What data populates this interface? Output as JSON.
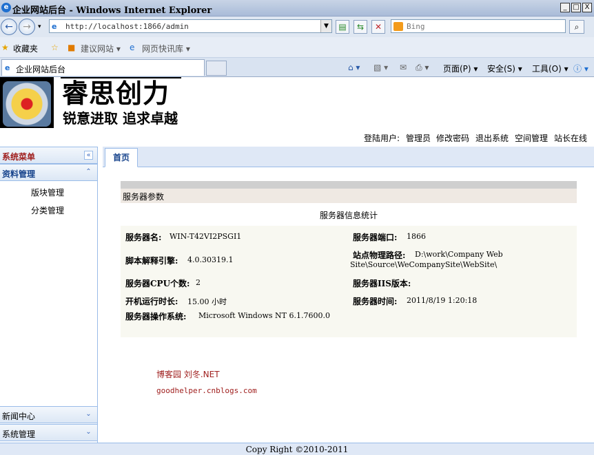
{
  "window": {
    "title": "企业网站后台 - Windows Internet Explorer",
    "minimize": "_",
    "maximize": "□",
    "close": "X"
  },
  "address": {
    "url": "http://localhost:1866/admin",
    "search_placeholder": "Bing"
  },
  "favorites": {
    "label": "收藏夹",
    "items": [
      "建议网站 ▾",
      "网页快讯库 ▾"
    ]
  },
  "browser_tab": {
    "title": "企业网站后台"
  },
  "commands": {
    "page": "页面(P) ▾",
    "safety": "安全(S) ▾",
    "tools": "工具(O) ▾"
  },
  "site": {
    "brand": "睿思创力",
    "slogan": "锐意进取 追求卓越"
  },
  "userbar": {
    "user_label": "登陆用户:",
    "user_name": "管理员",
    "links": [
      "修改密码",
      "退出系统",
      "空间管理",
      "站长在线"
    ]
  },
  "sidebar": {
    "title": "系统菜单",
    "groups": [
      {
        "label": "资料管理",
        "items": [
          "版块管理",
          "分类管理"
        ]
      },
      {
        "label": "新闻中心"
      },
      {
        "label": "系统管理"
      }
    ]
  },
  "tabs": {
    "home": "首页"
  },
  "server": {
    "section_title": "服务器参数",
    "stats_title": "服务器信息统计",
    "fields": [
      {
        "label": "服务器名:",
        "value": "WIN-T42VI2PSGI1"
      },
      {
        "label": "服务器端口:",
        "value": "1866"
      },
      {
        "label": "脚本解释引擎:",
        "value": "4.0.30319.1"
      },
      {
        "label": "站点物理路径:",
        "value": "D:\\work\\Company Web",
        "value2": "Site\\Source\\WeCompanySite\\WebSite\\"
      },
      {
        "label": "服务器CPU个数:",
        "value": "2"
      },
      {
        "label": "服务器IIS版本:",
        "value": ""
      },
      {
        "label": "开机运行时长:",
        "value": "15.00 小时"
      },
      {
        "label": "服务器时间:",
        "value": "2011/8/19 1:20:18"
      },
      {
        "label": "服务器操作系统:",
        "value": "Microsoft Windows NT 6.1.7600.0"
      }
    ]
  },
  "blog": {
    "name": "博客园 刘冬.NET",
    "url": "goodhelper.cnblogs.com"
  },
  "footer": {
    "copyright": "Copy Right ©2010-2011"
  }
}
